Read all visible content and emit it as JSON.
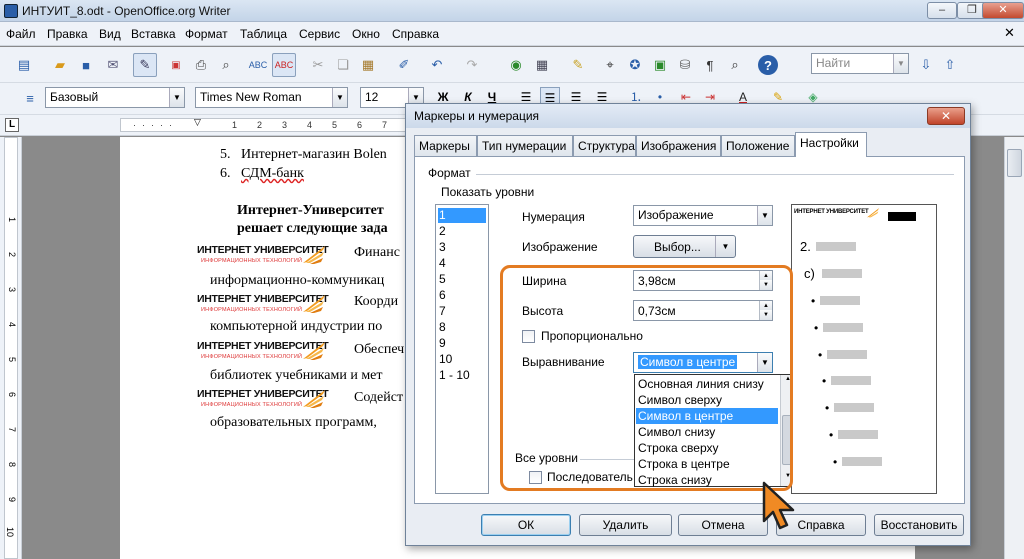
{
  "window": {
    "title": "ИНТУИТ_8.odt - OpenOffice.org Writer",
    "min": "‒",
    "max": "❐",
    "close": "✕"
  },
  "menu": [
    "Файл",
    "Правка",
    "Вид",
    "Вставка",
    "Формат",
    "Таблица",
    "Сервис",
    "Окно",
    "Справка"
  ],
  "toolbar": {
    "find_placeholder": "Найти"
  },
  "format": {
    "style": "Базовый",
    "font": "Times New Roman",
    "size": "12",
    "bold": "Ж",
    "italic": "К",
    "underline": "Ч"
  },
  "ruler": {
    "labels": [
      "1",
      "2",
      "3",
      "4",
      "5",
      "6",
      "7",
      "8"
    ],
    "vlabels": [
      "1",
      "2",
      "3",
      "4",
      "5",
      "6",
      "7",
      "8",
      "9",
      "10",
      "11",
      "12"
    ]
  },
  "document": {
    "list": [
      {
        "num": "5.",
        "text": "Интернет-магазин Bolen"
      },
      {
        "num": "6.",
        "text": "СДМ-банк"
      }
    ],
    "heading1": "Интернет-Университет",
    "heading2": "решает следующие зада",
    "logo_title": "ИНТЕРНЕТ УНИВЕРСИТЕТ",
    "logo_sub": "ИНФОРМАЦИОННЫХ ТЕХНОЛОГИЙ",
    "items": [
      {
        "first": "Финанс",
        "second": "информационно-коммуникац"
      },
      {
        "first": "Коорди",
        "second": "компьютерной индустрии по"
      },
      {
        "first": "Обеспеч",
        "second": "библиотек учебниками и мет"
      },
      {
        "first": "Содейст",
        "second": "образовательных программ,"
      }
    ]
  },
  "dialog": {
    "title": "Маркеры и нумерация",
    "close": "✕",
    "tabs": [
      "Маркеры",
      "Тип нумерации",
      "Структура",
      "Изображения",
      "Положение",
      "Настройки"
    ],
    "active_tab": "Настройки",
    "format_label": "Формат",
    "show_levels_label": "Показать уровни",
    "levels": [
      "1",
      "2",
      "3",
      "4",
      "5",
      "6",
      "7",
      "8",
      "9",
      "10",
      "1 - 10"
    ],
    "numbering_label": "Нумерация",
    "numbering_value": "Изображение",
    "image_label": "Изображение",
    "select_button": "Выбор...",
    "width_label": "Ширина",
    "width_value": "3,98см",
    "height_label": "Высота",
    "height_value": "0,73см",
    "proportional_label": "Пропорционально",
    "alignment_label": "Выравнивание",
    "alignment_value": "Символ в центре",
    "alignment_options": [
      "Основная линия снизу",
      "Символ сверху",
      "Символ в центре",
      "Символ снизу",
      "Строка сверху",
      "Строка в центре",
      "Строка снизу"
    ],
    "all_levels_label": "Все уровни",
    "consecutive_label": "Последователь",
    "preview": {
      "num2": "2.",
      "letter": "c)",
      "bullet": "•"
    },
    "buttons": {
      "ok": "ОК",
      "delete": "Удалить",
      "cancel": "Отмена",
      "help": "Справка",
      "reset": "Восстановить"
    }
  },
  "colors": {
    "highlight": "#e37b22",
    "selection": "#3399ff"
  }
}
